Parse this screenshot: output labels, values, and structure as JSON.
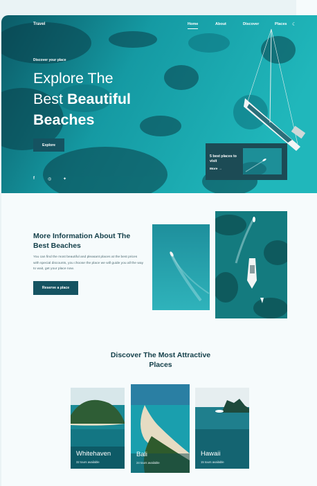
{
  "header": {
    "brand": "Travel",
    "nav": [
      "Home",
      "About",
      "Discover",
      "Places"
    ],
    "active_nav": "Home",
    "theme_icon": "moon-icon"
  },
  "hero": {
    "eyebrow": "Discover your place",
    "title_line1": "Explore The",
    "title_line2_a": "Best ",
    "title_line2_b": "Beautiful",
    "title_line3": "Beaches",
    "explore_label": "Explore",
    "social_icons": [
      "facebook-icon",
      "instagram-icon",
      "twitter-icon"
    ],
    "card": {
      "text": "5 best places to visit",
      "more": "More →"
    }
  },
  "info": {
    "title": "More Information About The Best Beaches",
    "text": "You can find the most beautiful and pleasant places at the best prices with special discounts, you choose the place we will guide you all the way to wait, get your place now.",
    "button": "Reserve a place"
  },
  "discover": {
    "title": "Discover The Most Attractive Places",
    "cards": [
      {
        "name": "Whitehaven",
        "sub": "32 tours available"
      },
      {
        "name": "Bali",
        "sub": "24 tours available"
      },
      {
        "name": "Hawaii",
        "sub": "15 tours available"
      }
    ]
  },
  "colors": {
    "primary": "#155361",
    "heading": "#123e48",
    "sea": "#1aa3a8",
    "background": "#f6fbfc"
  }
}
